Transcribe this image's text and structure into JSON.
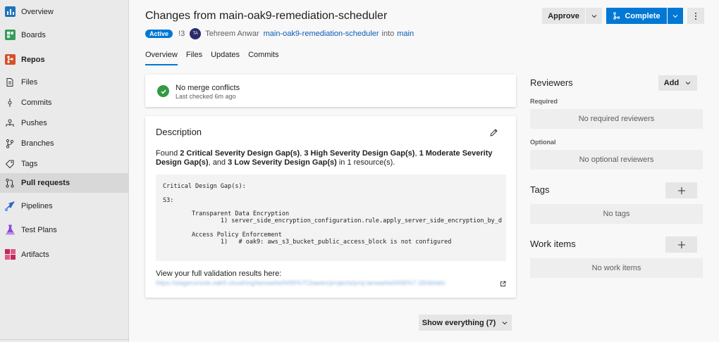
{
  "sidebar": {
    "items": [
      {
        "label": "Overview"
      },
      {
        "label": "Boards"
      },
      {
        "label": "Repos"
      },
      {
        "label": "Files"
      },
      {
        "label": "Commits"
      },
      {
        "label": "Pushes"
      },
      {
        "label": "Branches"
      },
      {
        "label": "Tags"
      },
      {
        "label": "Pull requests"
      },
      {
        "label": "Pipelines"
      },
      {
        "label": "Test Plans"
      },
      {
        "label": "Artifacts"
      }
    ]
  },
  "header": {
    "title": "Changes from main-oak9-remediation-scheduler",
    "status": "Active",
    "pr_id": "!3",
    "avatar_initials": "TA",
    "author": "Tehreem Anwar",
    "source_branch": "main-oak9-remediation-scheduler",
    "into": "into",
    "target_branch": "main",
    "approve_label": "Approve",
    "complete_label": "Complete"
  },
  "tabs": [
    {
      "label": "Overview"
    },
    {
      "label": "Files"
    },
    {
      "label": "Updates"
    },
    {
      "label": "Commits"
    }
  ],
  "merge": {
    "title": "No merge conflicts",
    "subtitle": "Last checked 6m ago"
  },
  "description": {
    "title": "Description",
    "p1": "Found ",
    "b1": "2 Critical Severity Design Gap(s)",
    "p2": ", ",
    "b2": "3 High Severity Design Gap(s)",
    "p3": ", ",
    "b3": "1 Moderate Severity Design Gap(s)",
    "p4": ", and ",
    "b4": "3 Low Severity Design Gap(s)",
    "p5": " in 1 resource(s).",
    "code": {
      "l1": "Critical Design Gap(s):",
      "l2": "S3:",
      "l3": "        Transparent Data Encryption",
      "l4": "                1) server_side_encryption_configuration.rule.apply_server_side_encryption_by_d",
      "l5": "        Access Policy Enforcement",
      "l6": "                1)   # oak9: aws_s3_bucket_public_access_block is not configured"
    },
    "view_label": "View your full validation results here:",
    "link_text": "https://stagecorsole.oak9.cloud/org/tanwarbe9496%7Cbawes/projects/proj-tanwarbe9496%7-28/details"
  },
  "show_everything": "Show everything (7)",
  "reviewers": {
    "title": "Reviewers",
    "add_label": "Add",
    "required_label": "Required",
    "required_empty": "No required reviewers",
    "optional_label": "Optional",
    "optional_empty": "No optional reviewers"
  },
  "tags": {
    "title": "Tags",
    "empty": "No tags"
  },
  "work_items": {
    "title": "Work items",
    "empty": "No work items"
  },
  "colors": {
    "accent": "#0078d4",
    "success": "#329a44",
    "link": "#0b5bb5"
  }
}
